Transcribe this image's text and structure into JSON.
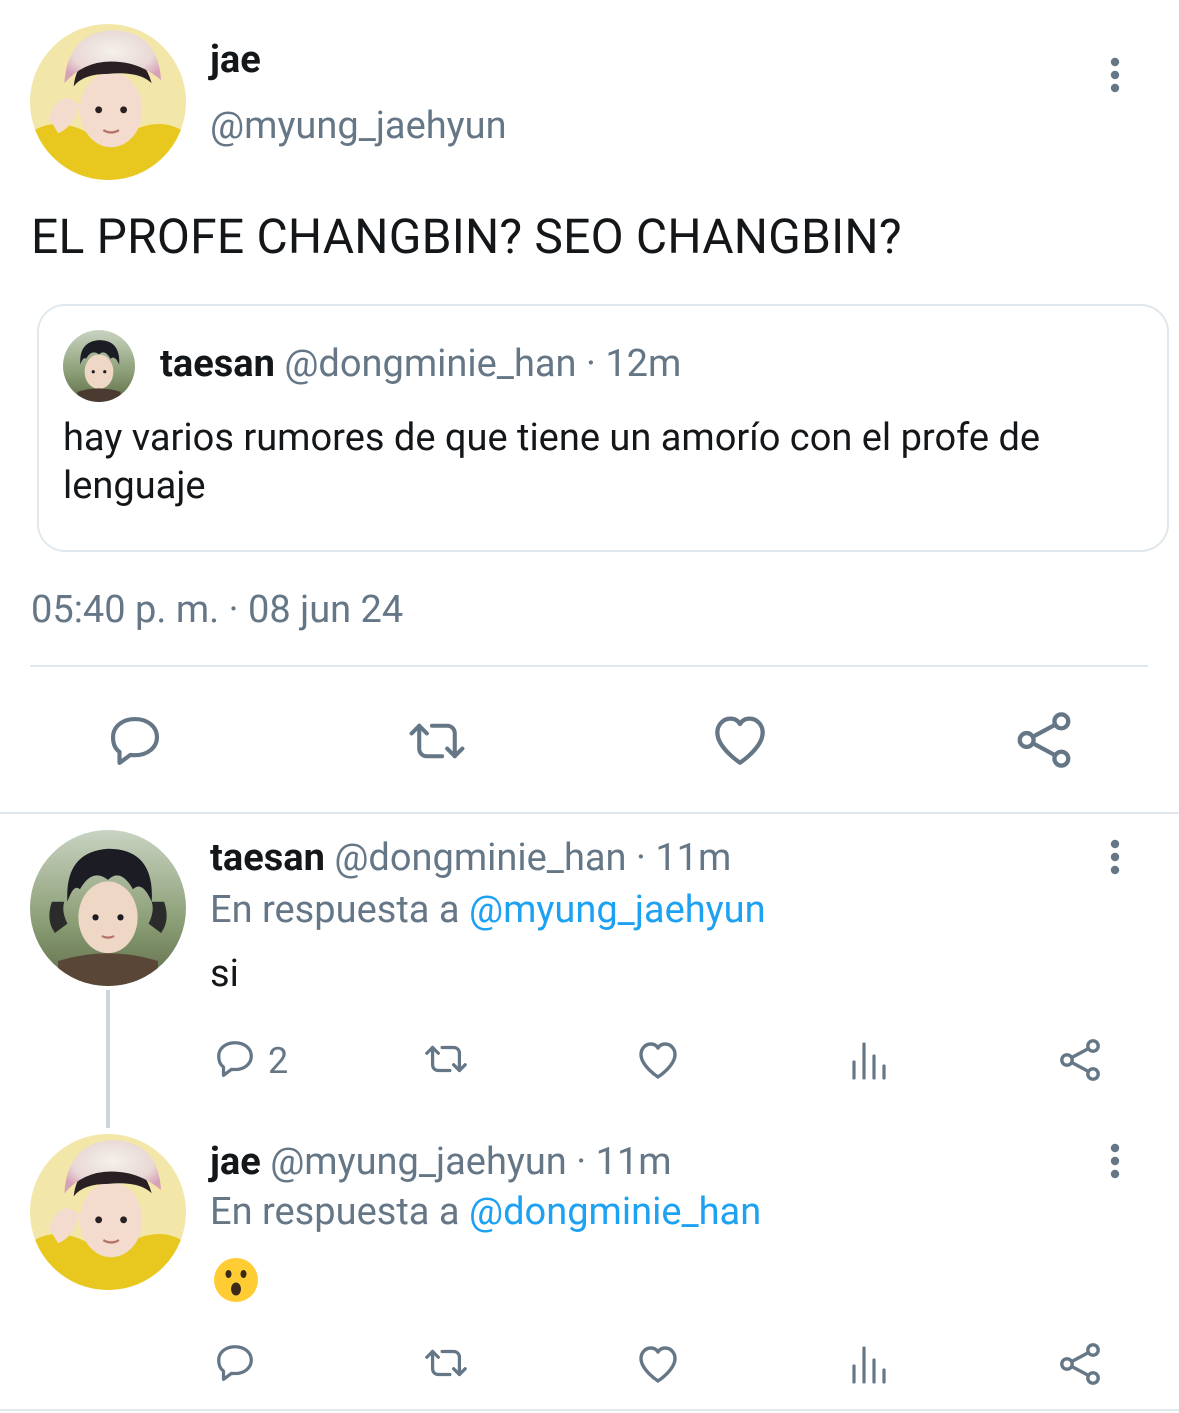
{
  "main_tweet": {
    "display_name": "jae",
    "handle": "@myung_jaehyun",
    "text": "EL PROFE CHANGBIN? SEO CHANGBIN?",
    "timestamp": "05:40 p. m. · 08 jun 24",
    "more_icon": "more-vertical-icon",
    "quoted": {
      "display_name": "taesan",
      "handle": "@dongminie_han",
      "time": "· 12m",
      "text": "hay varios rumores de que tiene un amorío con el profe de lenguaje"
    },
    "actions": [
      "reply-icon",
      "retweet-icon",
      "like-icon",
      "share-icon"
    ]
  },
  "replies": [
    {
      "display_name": "taesan",
      "handle": "@dongminie_han",
      "time": "· 11m",
      "reply_prefix": "En respuesta a",
      "reply_to": "@myung_jaehyun",
      "text": "si",
      "reply_count": "2",
      "actions": [
        "reply-icon",
        "retweet-icon",
        "like-icon",
        "stats-icon",
        "share-icon"
      ]
    },
    {
      "display_name": "jae",
      "handle": "@myung_jaehyun",
      "time": "· 11m",
      "reply_prefix": "En respuesta a",
      "reply_to": "@dongminie_han",
      "text": "😮",
      "reply_count": "",
      "actions": [
        "reply-icon",
        "retweet-icon",
        "like-icon",
        "stats-icon",
        "share-icon"
      ]
    }
  ],
  "colors": {
    "text": "#14171a",
    "secondary": "#657786",
    "link": "#1da1f2",
    "divider": "#e1e8ed"
  }
}
